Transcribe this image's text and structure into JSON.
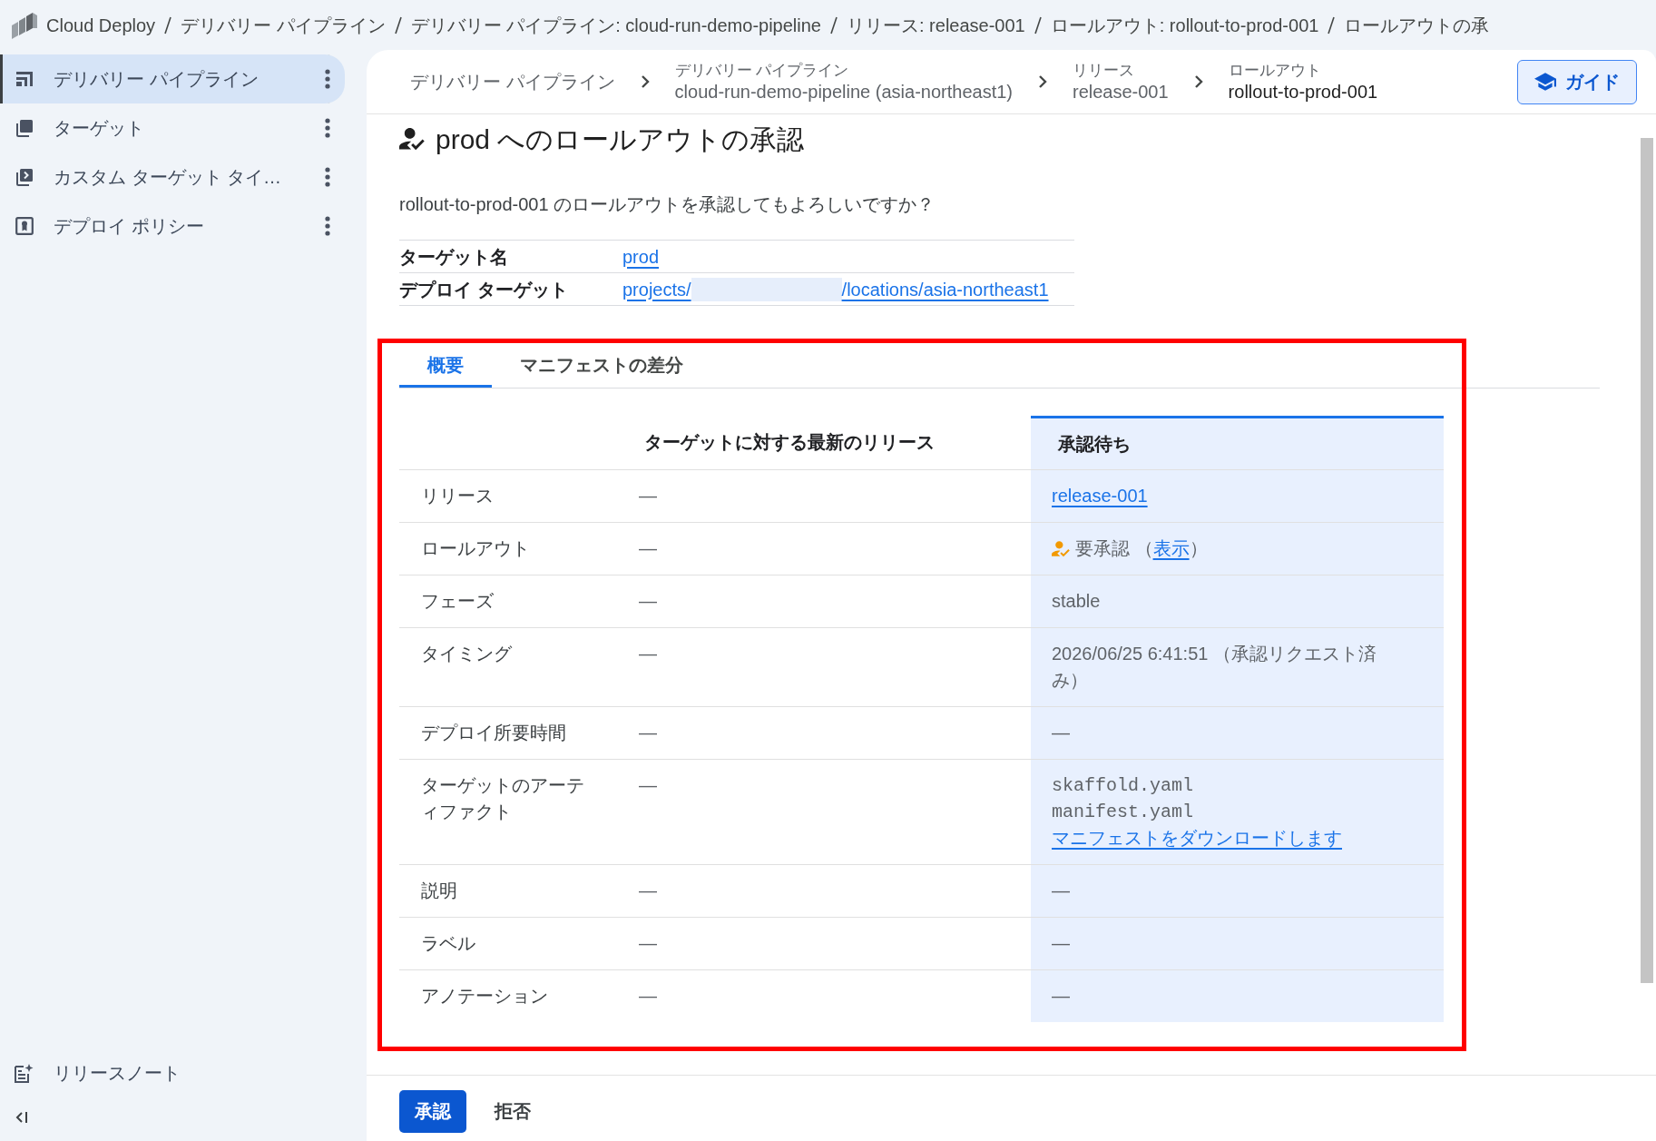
{
  "top_bar": {
    "breadcrumbs": [
      "Cloud Deploy",
      "デリバリー パイプライン",
      "デリバリー パイプライン: cloud-run-demo-pipeline",
      "リリース: release-001",
      "ロールアウト: rollout-to-prod-001",
      "ロールアウトの承"
    ]
  },
  "sidebar": {
    "items": [
      {
        "kind": "pipeline",
        "label": "デリバリー パイプライン",
        "selected": true
      },
      {
        "kind": "target",
        "label": "ターゲット",
        "selected": false
      },
      {
        "kind": "custom_target",
        "label": "カスタム ターゲット タイ…",
        "selected": false
      },
      {
        "kind": "policy",
        "label": "デプロイ ポリシー",
        "selected": false
      }
    ],
    "release_notes": "リリースノート"
  },
  "page_breadcrumbs": [
    {
      "label": "デリバリー パイプライン",
      "current": false
    },
    {
      "caption": "デリバリー パイプライン",
      "label": "cloud-run-demo-pipeline (asia-northeast1)",
      "current": false
    },
    {
      "caption": "リリース",
      "label": "release-001",
      "current": false
    },
    {
      "caption": "ロールアウト",
      "label": "rollout-to-prod-001",
      "current": true
    }
  ],
  "guide_button": "ガイド",
  "approval": {
    "title": "prod へのロールアウトの承認",
    "question": "rollout-to-prod-001 のロールアウトを承認してもよろしいですか？",
    "details": [
      {
        "label": "ターゲット名",
        "kind": "link",
        "value": "prod"
      },
      {
        "label": "デプロイ ターゲット",
        "kind": "redacted_link",
        "prefix": "projects/",
        "suffix": "/locations/asia-northeast1"
      }
    ]
  },
  "tabs": [
    {
      "label": "概要",
      "selected": true
    },
    {
      "label": "マニフェストの差分",
      "selected": false
    }
  ],
  "comparison": {
    "columns": [
      {
        "label": "ターゲットに対する最新のリリース",
        "highlighted": false
      },
      {
        "label": "承認待ち",
        "highlighted": true
      }
    ],
    "rows": [
      {
        "label": "リリース",
        "values": [
          {
            "kind": "text",
            "text": "—"
          },
          {
            "kind": "link",
            "text": "release-001"
          }
        ]
      },
      {
        "label": "ロールアウト",
        "values": [
          {
            "kind": "text",
            "text": "—"
          },
          {
            "kind": "status",
            "before": "要承認 （",
            "link": "表示",
            "after": "）"
          }
        ]
      },
      {
        "label": "フェーズ",
        "values": [
          {
            "kind": "text",
            "text": "—"
          },
          {
            "kind": "text",
            "text": "stable"
          }
        ]
      },
      {
        "label": "タイミング",
        "values": [
          {
            "kind": "text",
            "text": "—"
          },
          {
            "kind": "text",
            "text": "2026/06/25 6:41:51 （承認リクエスト済み）"
          }
        ]
      },
      {
        "label": "デプロイ所要時間",
        "values": [
          {
            "kind": "text",
            "text": "—"
          },
          {
            "kind": "text",
            "text": "—"
          }
        ]
      },
      {
        "label": "ターゲットのアーティファクト",
        "values": [
          {
            "kind": "text",
            "text": "—"
          },
          {
            "kind": "files",
            "files": [
              "skaffold.yaml",
              "manifest.yaml"
            ],
            "link": "マニフェストをダウンロードします"
          }
        ]
      },
      {
        "label": "説明",
        "values": [
          {
            "kind": "text",
            "text": "—"
          },
          {
            "kind": "text",
            "text": "—"
          }
        ]
      },
      {
        "label": "ラベル",
        "values": [
          {
            "kind": "text",
            "text": "—"
          },
          {
            "kind": "text",
            "text": "—"
          }
        ]
      },
      {
        "label": "アノテーション",
        "values": [
          {
            "kind": "text",
            "text": "—"
          },
          {
            "kind": "text",
            "text": "—"
          }
        ]
      }
    ]
  },
  "actions": [
    {
      "kind": "primary",
      "label": "承認"
    },
    {
      "kind": "text",
      "label": "拒否"
    }
  ]
}
